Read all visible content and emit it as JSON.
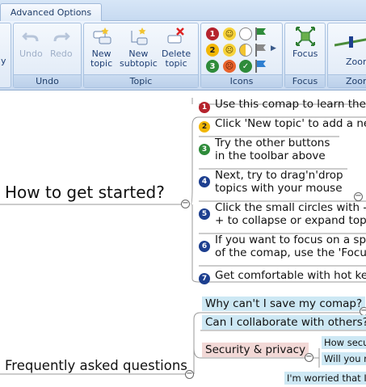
{
  "tabs": {
    "advanced_options": "Advanced Options"
  },
  "ribbon": {
    "undo_group": {
      "label": "Undo",
      "undo": "Undo",
      "redo": "Redo",
      "partial_left": "y"
    },
    "topic_group": {
      "label": "Topic",
      "new_topic": [
        "New",
        "topic"
      ],
      "new_subtopic": [
        "New",
        "subtopic"
      ],
      "delete_topic": [
        "Delete",
        "topic"
      ]
    },
    "icons_group": {
      "label": "Icons",
      "numbers": [
        "1",
        "2",
        "3"
      ]
    },
    "focus_group": {
      "label": "Focus",
      "focus": "Focus"
    },
    "zoom_group": {
      "label": "Zoon",
      "zoom": "Zoon"
    }
  },
  "mindmap": {
    "how_to": {
      "title": "How to get started?",
      "items": [
        {
          "num": "1",
          "color": "red",
          "lines": [
            "Use this comap to learn the"
          ]
        },
        {
          "num": "2",
          "color": "yellow",
          "lines": [
            "Click 'New topic' to add a ne"
          ]
        },
        {
          "num": "3",
          "color": "green",
          "lines": [
            "Try the other buttons",
            "in the toolbar above"
          ]
        },
        {
          "num": "4",
          "color": "blue",
          "lines": [
            "Next, try to drag'n'drop",
            "topics with your mouse"
          ]
        },
        {
          "num": "5",
          "color": "blue",
          "lines": [
            "Click the small circles with -",
            "+ to collapse or expand top"
          ]
        },
        {
          "num": "6",
          "color": "blue",
          "lines": [
            "If you want to focus on a sp",
            "of the comap, use the 'Focu"
          ]
        },
        {
          "num": "7",
          "color": "blue",
          "lines": [
            "Get comfortable with hot ke"
          ]
        }
      ]
    },
    "faq": {
      "title": "Frequently asked questions",
      "q1": "Why can't I save my comap?",
      "q2": "Can I collaborate with others?",
      "q3": "Security & privacy",
      "q3_sub1": "How secu",
      "q3_sub2": "Will you r",
      "q4": "I'm worried that I'"
    }
  },
  "colors": {
    "ribbon_bg": "#d5e3f4",
    "accent_text": "#1f3f74",
    "faq_highlight": "#cde8f4",
    "security_highlight": "#f2d8d6"
  }
}
